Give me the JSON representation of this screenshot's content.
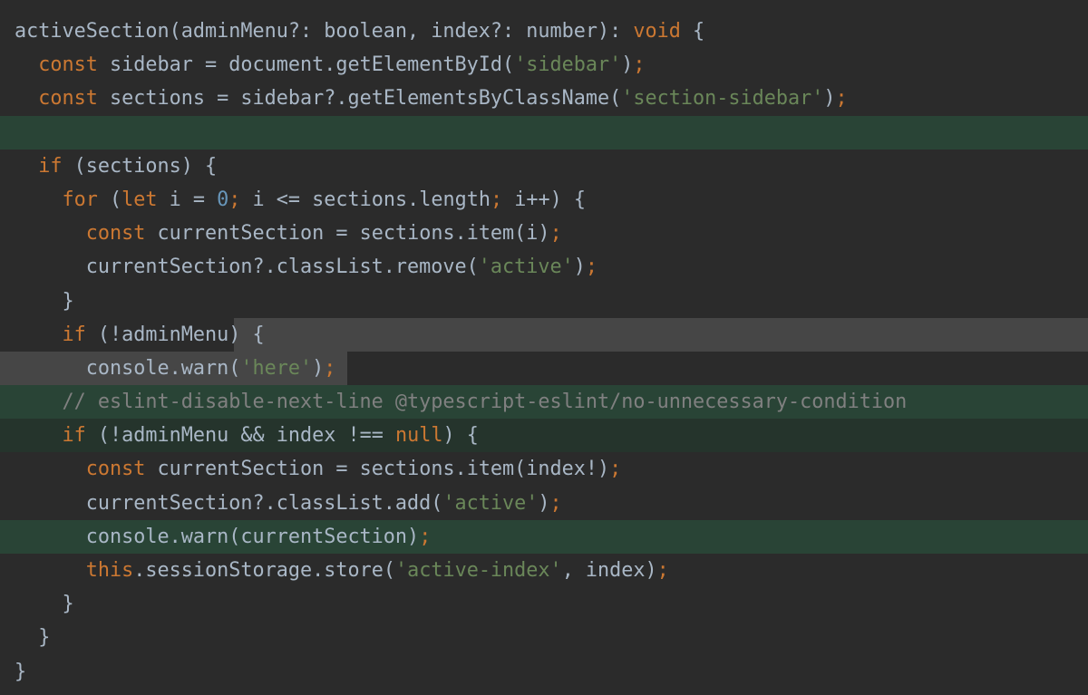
{
  "theme": {
    "background": "#2b2b2b",
    "colors": {
      "plain": "#a9b7c6",
      "kw": "#cc7832",
      "str": "#6a8759",
      "num": "#6897bb",
      "cm": "#808080"
    },
    "highlights": {
      "green": "#294436",
      "dark-green": "#25342c",
      "gray": "#464646",
      "light-gray": "#3c3f41"
    }
  },
  "lines": [
    {
      "tokens": [
        {
          "t": "activeSection(adminMenu?: boolean, index?: number): ",
          "c": "plain"
        },
        {
          "t": "void",
          "c": "kw"
        },
        {
          "t": " {",
          "c": "plain"
        }
      ]
    },
    {
      "tokens": [
        {
          "t": "  ",
          "c": "plain"
        },
        {
          "t": "const",
          "c": "kw"
        },
        {
          "t": " sidebar = document.getElementById(",
          "c": "plain"
        },
        {
          "t": "'sidebar'",
          "c": "str"
        },
        {
          "t": ")",
          "c": "plain"
        },
        {
          "t": ";",
          "c": "kw"
        }
      ]
    },
    {
      "tokens": [
        {
          "t": "  ",
          "c": "plain"
        },
        {
          "t": "const",
          "c": "kw"
        },
        {
          "t": " sections = sidebar?.getElementsByClassName(",
          "c": "plain"
        },
        {
          "t": "'section-sidebar'",
          "c": "str"
        },
        {
          "t": ")",
          "c": "plain"
        },
        {
          "t": ";",
          "c": "kw"
        }
      ]
    },
    {
      "hl": "green",
      "tokens": []
    },
    {
      "tokens": [
        {
          "t": "  ",
          "c": "plain"
        },
        {
          "t": "if",
          "c": "kw"
        },
        {
          "t": " (sections) {",
          "c": "plain"
        }
      ]
    },
    {
      "tokens": [
        {
          "t": "    ",
          "c": "plain"
        },
        {
          "t": "for",
          "c": "kw"
        },
        {
          "t": " (",
          "c": "plain"
        },
        {
          "t": "let",
          "c": "kw"
        },
        {
          "t": " i = ",
          "c": "plain"
        },
        {
          "t": "0",
          "c": "num"
        },
        {
          "t": ";",
          "c": "kw"
        },
        {
          "t": " i <= sections.length",
          "c": "plain"
        },
        {
          "t": ";",
          "c": "kw"
        },
        {
          "t": " i++) {",
          "c": "plain"
        }
      ]
    },
    {
      "tokens": [
        {
          "t": "      ",
          "c": "plain"
        },
        {
          "t": "const",
          "c": "kw"
        },
        {
          "t": " currentSection = sections.item(i)",
          "c": "plain"
        },
        {
          "t": ";",
          "c": "kw"
        }
      ]
    },
    {
      "tokens": [
        {
          "t": "      currentSection?.classList.remove(",
          "c": "plain"
        },
        {
          "t": "'active'",
          "c": "str"
        },
        {
          "t": ")",
          "c": "plain"
        },
        {
          "t": ";",
          "c": "kw"
        }
      ]
    },
    {
      "tokens": [
        {
          "t": "    }",
          "c": "plain"
        }
      ]
    },
    {
      "hl": "gray",
      "hlFrom": 258,
      "tokens": [
        {
          "t": "    ",
          "c": "plain"
        },
        {
          "t": "if",
          "c": "kw"
        },
        {
          "t": " (!adminMenu) {",
          "c": "plain"
        }
      ]
    },
    {
      "hl": "gray",
      "hlTo": 383,
      "tokens": [
        {
          "t": "      console.warn(",
          "c": "plain"
        },
        {
          "t": "'here'",
          "c": "str"
        },
        {
          "t": ")",
          "c": "plain"
        },
        {
          "t": ";",
          "c": "kw"
        }
      ]
    },
    {
      "hl": "green",
      "tokens": [
        {
          "t": "    // eslint-disable-next-line @typescript-eslint/no-unnecessary-condition",
          "c": "cm"
        }
      ]
    },
    {
      "hl": "dark-green",
      "tokens": [
        {
          "t": "    ",
          "c": "plain"
        },
        {
          "t": "if",
          "c": "kw"
        },
        {
          "t": " (!adminMenu && index !== ",
          "c": "plain"
        },
        {
          "t": "null",
          "c": "kw"
        },
        {
          "t": ") {",
          "c": "plain"
        }
      ]
    },
    {
      "tokens": [
        {
          "t": "      ",
          "c": "plain"
        },
        {
          "t": "const",
          "c": "kw"
        },
        {
          "t": " currentSection = sections.item(index!)",
          "c": "plain"
        },
        {
          "t": ";",
          "c": "kw"
        }
      ]
    },
    {
      "tokens": [
        {
          "t": "      currentSection?.classList.add(",
          "c": "plain"
        },
        {
          "t": "'active'",
          "c": "str"
        },
        {
          "t": ")",
          "c": "plain"
        },
        {
          "t": ";",
          "c": "kw"
        }
      ]
    },
    {
      "hl": "green",
      "tokens": [
        {
          "t": "      console.warn(currentSection)",
          "c": "plain"
        },
        {
          "t": ";",
          "c": "kw"
        }
      ]
    },
    {
      "tokens": [
        {
          "t": "      ",
          "c": "plain"
        },
        {
          "t": "this",
          "c": "kw"
        },
        {
          "t": ".sessionStorage.store(",
          "c": "plain"
        },
        {
          "t": "'active-index'",
          "c": "str"
        },
        {
          "t": ", index)",
          "c": "plain"
        },
        {
          "t": ";",
          "c": "kw"
        }
      ]
    },
    {
      "tokens": [
        {
          "t": "    }",
          "c": "plain"
        }
      ]
    },
    {
      "tokens": [
        {
          "t": "  }",
          "c": "plain"
        }
      ]
    },
    {
      "tokens": [
        {
          "t": "}",
          "c": "plain"
        }
      ]
    }
  ]
}
